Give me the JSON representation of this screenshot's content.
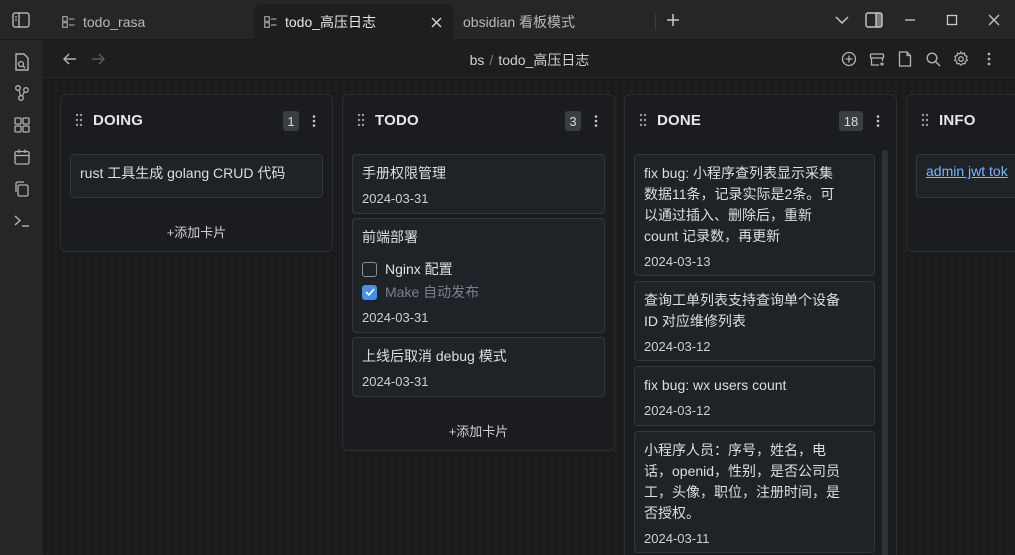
{
  "tabs": [
    {
      "label": "todo_rasa"
    },
    {
      "label": "todo_高压日志"
    },
    {
      "label": "obsidian 看板模式"
    }
  ],
  "breadcrumb": {
    "folder": "bs",
    "separator": "/",
    "file": "todo_高压日志"
  },
  "icons": {
    "sidebar_toggle": "sidebar-toggle-icon",
    "tab_file": "kanban-board-icon",
    "tab_close": "close-icon",
    "new_tab": "plus-icon",
    "tab_list": "chevron-down-icon",
    "right_sidebar": "right-sidebar-icon",
    "minimize": "minimize-icon",
    "maximize": "maximize-icon",
    "close_window": "close-icon",
    "ribbon": [
      "open-files-icon",
      "graph-view-icon",
      "canvas-icon",
      "daily-note-icon",
      "copy-icon",
      "terminal-icon"
    ],
    "nav": [
      "back-arrow-icon",
      "forward-arrow-icon",
      "add-list-icon",
      "archive-icon",
      "markdown-view-icon",
      "search-icon",
      "settings-icon",
      "more-icon"
    ]
  },
  "lanes": [
    {
      "title": "DOING",
      "count": "1",
      "cards": [
        {
          "text": "rust 工具生成 golang CRUD 代码"
        }
      ],
      "add_label": "+添加卡片"
    },
    {
      "title": "TODO",
      "count": "3",
      "cards": [
        {
          "text": "手册权限管理",
          "date": "2024-03-31"
        },
        {
          "text": "前端部署",
          "checklist": [
            {
              "label": "Nginx 配置",
              "checked": false
            },
            {
              "label": "Make 自动发布",
              "checked": true
            }
          ],
          "date": "2024-03-31"
        },
        {
          "text": "上线后取消 debug 模式",
          "date": "2024-03-31"
        }
      ],
      "add_label": "+添加卡片"
    },
    {
      "title": "DONE",
      "count": "18",
      "cards": [
        {
          "lines": [
            "fix bug: 小程序查列表显示采集",
            "数据11条，记录实际是2条。可",
            "以通过插入、删除后，重新",
            "count 记录数，再更新"
          ],
          "date": "2024-03-13"
        },
        {
          "lines": [
            "查询工单列表支持查询单个设备",
            "ID 对应维修列表"
          ],
          "date": "2024-03-12"
        },
        {
          "lines": [
            "fix bug: wx users count"
          ],
          "date": "2024-03-12"
        },
        {
          "lines": [
            "小程序人员：序号，姓名，电",
            "话，openid，性别，是否公司员",
            "工，头像，职位，注册时间，是",
            "否授权。"
          ],
          "date": "2024-03-11"
        }
      ]
    },
    {
      "title": "INFO",
      "cards": [
        {
          "link": "admin jwt tok"
        }
      ]
    }
  ],
  "colors": {
    "accent": "#4a8fe8",
    "link": "#7fb4ff",
    "lane_bg": "#1a1c1f",
    "card_bg": "#1f2226"
  }
}
